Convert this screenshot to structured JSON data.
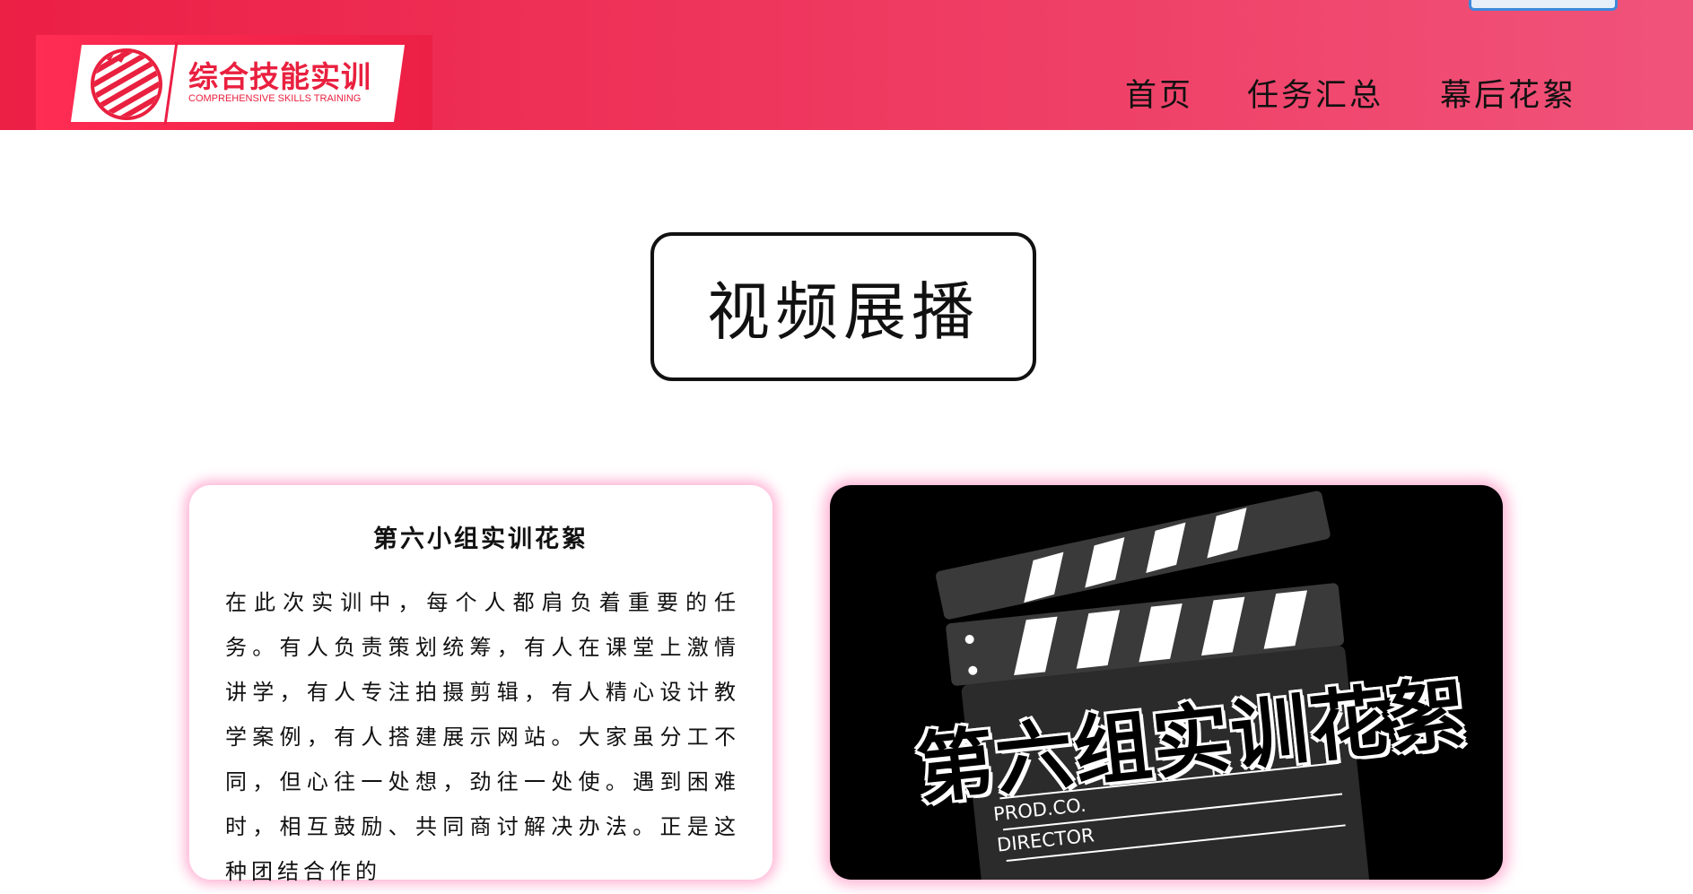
{
  "header": {
    "logo": {
      "title": "综合技能实训",
      "subtitle": "COMPREHENSIVE SKILLS TRAINING",
      "icon": "striped-circle-emblem"
    },
    "nav": [
      {
        "label": "首页"
      },
      {
        "label": "任务汇总"
      },
      {
        "label": "幕后花絮"
      }
    ],
    "accent_color": "#ec1f45"
  },
  "section": {
    "title": "视频展播"
  },
  "text_card": {
    "title": "第六小组实训花絮",
    "body": "在此次实训中，每个人都肩负着重要的任务。有人负责策划统筹，有人在课堂上激情讲学，有人专注拍摄剪辑，有人精心设计教学案例，有人搭建展示网站。大家虽分工不同，但心往一处想，劲往一处使。遇到困难时，相互鼓励、共同商讨解决办法。正是这种团结合作的"
  },
  "video_card": {
    "caption": "第六组实训花絮",
    "slate_labels": [
      "PROD.CO.",
      "DIRECTOR"
    ],
    "icon": "clapperboard-icon"
  }
}
